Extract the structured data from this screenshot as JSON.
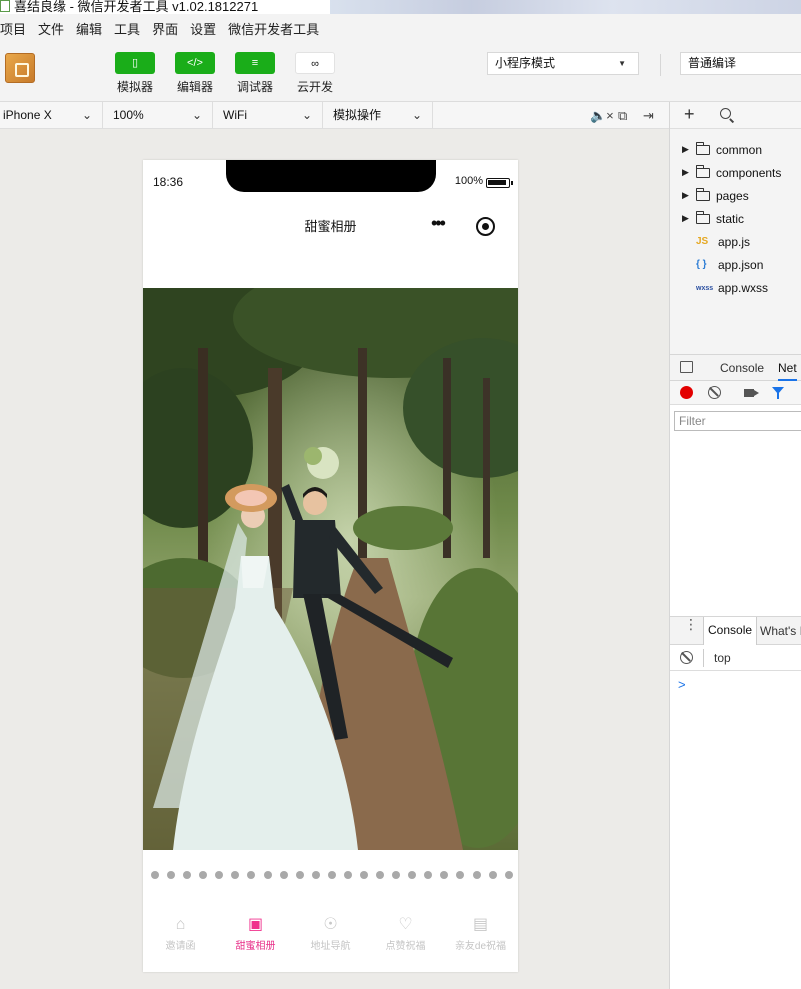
{
  "window": {
    "title": "喜结良缘 - 微信开发者工具 v1.02.1812271"
  },
  "menu": {
    "items": [
      "项目",
      "文件",
      "编辑",
      "工具",
      "界面",
      "设置",
      "微信开发者工具"
    ]
  },
  "toolbar": {
    "simulator_label": "模拟器",
    "editor_label": "编辑器",
    "debugger_label": "调试器",
    "cloud_label": "云开发",
    "mode_select": "小程序模式",
    "compile_select": "普通编译"
  },
  "device_bar": {
    "device": "iPhone X",
    "zoom": "100%",
    "network": "WiFi",
    "operation": "模拟操作"
  },
  "file_tree": {
    "folders": [
      "common",
      "components",
      "pages",
      "static"
    ],
    "files": [
      {
        "icon": "JS",
        "name": "app.js",
        "color": "#e5a823"
      },
      {
        "icon": "{ }",
        "name": "app.json",
        "color": "#2a7bd4"
      },
      {
        "icon": "wxss",
        "name": "app.wxss",
        "color": "#2a4fa0"
      }
    ]
  },
  "devtools": {
    "tab_console": "Console",
    "tab_network": "Net",
    "filter_placeholder": "Filter",
    "drawer_tab_console": "Console",
    "drawer_tab_whatsnew": "What's I",
    "context": "top",
    "prompt": ">"
  },
  "phone": {
    "time": "18:36",
    "battery": "100%",
    "nav_title": "甜蜜相册",
    "capsule_more": "•••"
  },
  "swiper": {
    "dot_count": 23
  },
  "tabbar": {
    "items": [
      {
        "label": "邀请函",
        "icon": "home-icon",
        "active": false
      },
      {
        "label": "甜蜜相册",
        "icon": "photo-icon",
        "active": true
      },
      {
        "label": "地址导航",
        "icon": "location-icon",
        "active": false
      },
      {
        "label": "点赞祝福",
        "icon": "heart-icon",
        "active": false
      },
      {
        "label": "亲友de祝福",
        "icon": "message-icon",
        "active": false
      }
    ]
  },
  "colors": {
    "accent": "#1aad19",
    "tab_active": "#f0318d",
    "record": "#e30000",
    "link": "#1a73e8"
  }
}
